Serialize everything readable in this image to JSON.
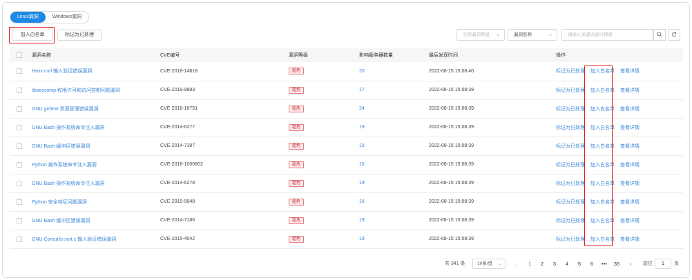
{
  "tabs": [
    {
      "label": "Linux漏洞",
      "active": true
    },
    {
      "label": "Windows漏洞",
      "active": false
    }
  ],
  "toolbar": {
    "add_whitelist": "加入白名单",
    "mark_handled": "标记为已处理"
  },
  "filters": {
    "level_placeholder": "全部漏洞等级",
    "field_value": "漏洞名称",
    "search_placeholder": "请输入关键词进行搜索"
  },
  "table": {
    "headers": [
      "漏洞名称",
      "CVE编号",
      "漏洞等级",
      "影响服务器数量",
      "最后发现时间",
      "操作"
    ],
    "actions": {
      "mark": "标记为已处理",
      "whitelist": "加入白名单",
      "detail": "查看详情"
    },
    "rows": [
      {
        "name": "Haxx curl 输入验证错误漏洞",
        "cve": "CVE-2018-14618",
        "level": "超危",
        "count": "20",
        "time": "2022-08-15 15:08:40"
      },
      {
        "name": "libseccomp 权限许可和访问控制问题漏洞",
        "cve": "CVE-2019-9893",
        "level": "超危",
        "count": "17",
        "time": "2022-08-15 15:08:39"
      },
      {
        "name": "GNU gettext 资源管理错误漏洞",
        "cve": "CVE-2018-18751",
        "level": "超危",
        "count": "24",
        "time": "2022-08-15 15:08:39"
      },
      {
        "name": "GNU Bash 操作系统命令注入漏洞",
        "cve": "CVE-2014-6277",
        "level": "超危",
        "count": "19",
        "time": "2022-08-15 15:08:39"
      },
      {
        "name": "GNU Bash 缓冲区错误漏洞",
        "cve": "CVE-2014-7187",
        "level": "超危",
        "count": "19",
        "time": "2022-08-15 15:08:39"
      },
      {
        "name": "Python 操作系统命令注入漏洞",
        "cve": "CVE-2018-1000802",
        "level": "超危",
        "count": "16",
        "time": "2022-08-15 15:08:39"
      },
      {
        "name": "GNU Bash 操作系统命令注入漏洞",
        "cve": "CVE-2014-6278",
        "level": "超危",
        "count": "19",
        "time": "2022-08-15 15:08:39"
      },
      {
        "name": "Python 安全特征问题漏洞",
        "cve": "CVE-2019-9948",
        "level": "超危",
        "count": "16",
        "time": "2022-08-15 15:08:39"
      },
      {
        "name": "GNU Bash 缓冲区错误漏洞",
        "cve": "CVE-2014-7186",
        "level": "超危",
        "count": "19",
        "time": "2022-08-15 15:08:39"
      },
      {
        "name": "GNU Coreutils sort.c 输入验证错误漏洞",
        "cve": "CVE-2015-4042",
        "level": "超危",
        "count": "19",
        "time": "2022-08-15 15:08:39"
      }
    ]
  },
  "pagination": {
    "total": "共 341 条",
    "page_size": "10条/页",
    "pages": [
      "1",
      "2",
      "3",
      "4",
      "5",
      "6",
      "•••",
      "35"
    ],
    "current": "1",
    "goto_label": "前往",
    "goto_value": "1",
    "goto_suffix": "页"
  },
  "colors": {
    "accent": "#1e88e5",
    "danger": "#c0272d",
    "highlight_box": "#e11a1a"
  }
}
